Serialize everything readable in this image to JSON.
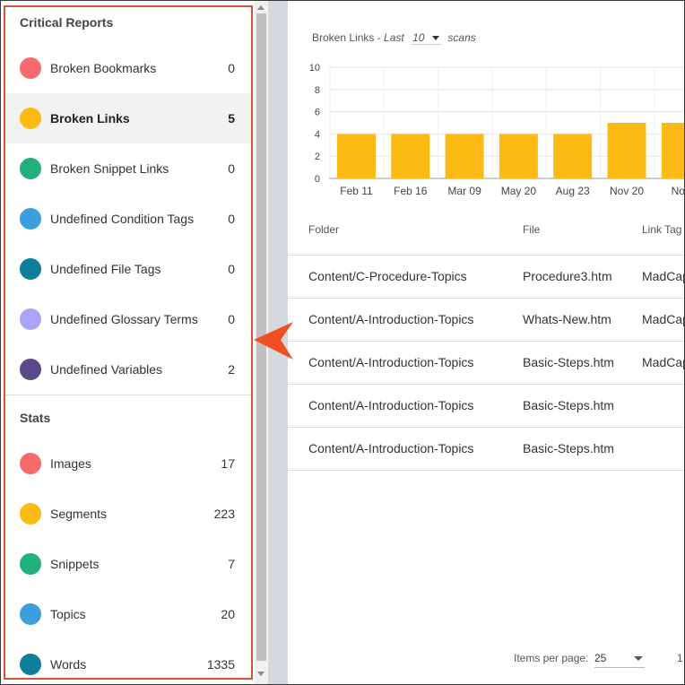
{
  "sidebar": {
    "critical_title": "Critical Reports",
    "critical_items": [
      {
        "label": "Broken Bookmarks",
        "count": "0",
        "color": "#f66a6a"
      },
      {
        "label": "Broken Links",
        "count": "5",
        "color": "#fbbb14",
        "selected": true
      },
      {
        "label": "Broken Snippet Links",
        "count": "0",
        "color": "#22b07d"
      },
      {
        "label": "Undefined Condition Tags",
        "count": "0",
        "color": "#3a9fdc"
      },
      {
        "label": "Undefined File Tags",
        "count": "0",
        "color": "#0e7f98"
      },
      {
        "label": "Undefined Glossary Terms",
        "count": "0",
        "color": "#a9a4f5"
      },
      {
        "label": "Undefined Variables",
        "count": "2",
        "color": "#5a4a8c"
      }
    ],
    "stats_title": "Stats",
    "stats_items": [
      {
        "label": "Images",
        "count": "17",
        "color": "#f66a6a"
      },
      {
        "label": "Segments",
        "count": "223",
        "color": "#fbbb14"
      },
      {
        "label": "Snippets",
        "count": "7",
        "color": "#22b07d"
      },
      {
        "label": "Topics",
        "count": "20",
        "color": "#3a9fdc"
      },
      {
        "label": "Words",
        "count": "1335",
        "color": "#0e7f98"
      }
    ]
  },
  "chart_header": {
    "prefix": "Broken Links - ",
    "last": "Last",
    "scan_count": "10",
    "suffix": "scans"
  },
  "chart_data": {
    "type": "bar",
    "categories": [
      "Feb 11",
      "Feb 16",
      "Mar 09",
      "May 20",
      "Aug 23",
      "Nov 20",
      "Nov"
    ],
    "values": [
      4,
      4,
      4,
      4,
      4,
      5,
      5
    ],
    "ylim": [
      0,
      10
    ],
    "yticks": [
      "0",
      "2",
      "4",
      "6",
      "8",
      "10"
    ],
    "bar_color": "#fbbb14",
    "grid": true
  },
  "table": {
    "headers": [
      "Folder",
      "File",
      "Link Tag"
    ],
    "rows": [
      [
        "Content/C-Procedure-Topics",
        "Procedure3.htm",
        "MadCap"
      ],
      [
        "Content/A-Introduction-Topics",
        "Whats-New.htm",
        "MadCap"
      ],
      [
        "Content/A-Introduction-Topics",
        "Basic-Steps.htm",
        "MadCap"
      ],
      [
        "Content/A-Introduction-Topics",
        "Basic-Steps.htm",
        ""
      ],
      [
        "Content/A-Introduction-Topics",
        "Basic-Steps.htm",
        ""
      ]
    ]
  },
  "paginator": {
    "label": "Items per page:",
    "page_size": "25",
    "range": "1"
  },
  "callout_color": "#f04e23"
}
